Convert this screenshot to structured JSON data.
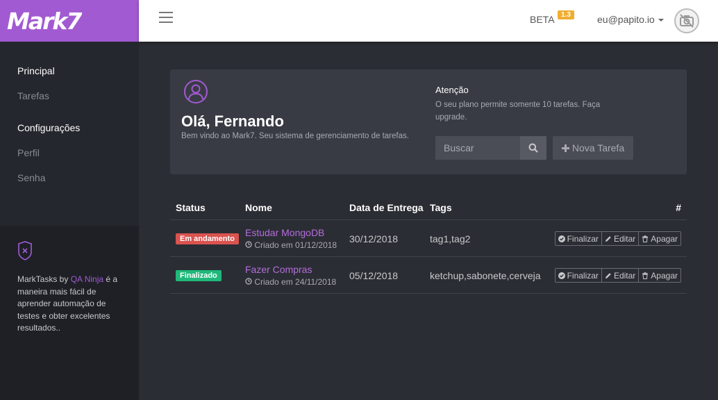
{
  "brand": {
    "logo_text": "Mark7",
    "accent": "#a25ad2"
  },
  "topbar": {
    "beta_label": "BETA",
    "version": "1.3",
    "user_email": "eu@papito.io"
  },
  "sidebar": {
    "sections": [
      {
        "heading": "Principal",
        "items": [
          "Tarefas"
        ]
      },
      {
        "heading": "Configurações",
        "items": [
          "Perfil",
          "Senha"
        ]
      }
    ],
    "promo": {
      "before": "MarkTasks by ",
      "link": "QA Ninja",
      "after": " é a maneira mais fácil de aprender automação de testes e obter excelentes resultados.."
    }
  },
  "panel": {
    "greeting": "Olá, Fernando",
    "welcome": "Bem vindo ao Mark7. Seu sistema de gerenciamento de tarefas.",
    "attention_title": "Atenção",
    "attention_text": "O seu plano permite somente 10 tarefas. Faça upgrade.",
    "search_placeholder": "Buscar",
    "new_task_label": "Nova Tarefa"
  },
  "table": {
    "headers": {
      "status": "Status",
      "name": "Nome",
      "due": "Data de Entrega",
      "tags": "Tags",
      "actions": "#"
    },
    "rows": [
      {
        "status": "Em andamento",
        "status_color": "#d9534f",
        "name": "Estudar MongoDB",
        "created": "Criado em 01/12/2018",
        "due": "30/12/2018",
        "tags": "tag1,tag2"
      },
      {
        "status": "Finalizado",
        "status_color": "#1fb87a",
        "name": "Fazer Compras",
        "created": "Criado em 24/11/2018",
        "due": "05/12/2018",
        "tags": "ketchup,sabonete,cerveja"
      }
    ],
    "action_labels": {
      "finish": "Finalizar",
      "edit": "Editar",
      "delete": "Apagar"
    }
  }
}
